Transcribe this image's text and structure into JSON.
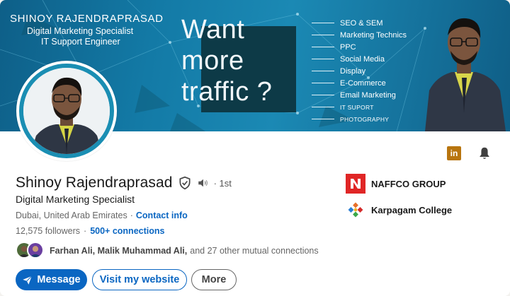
{
  "banner": {
    "name": "SHINOY RAJENDRAPRASAD",
    "subtitle1": "Digital Marketing Specialist",
    "subtitle2": "IT Support Engineer",
    "headline": [
      "Want",
      "more",
      "traffic ?"
    ],
    "services": [
      "SEO & SEM",
      "Marketing Technics",
      "PPC",
      "Social Media",
      "Display",
      "E-Commerce",
      "Email Marketing",
      "IT SUPORT",
      "PHOTOGRAPHY"
    ]
  },
  "profile": {
    "name": "Shinoy Rajendraprasad",
    "degree": "· 1st",
    "headline": "Digital Marketing Specialist",
    "location": "Dubai, United Arab Emirates",
    "contact_label": "Contact info",
    "followers": "12,575 followers",
    "connections": "500+ connections",
    "mutual_names": "Farhan Ali, Malik Muhammad Ali,",
    "mutual_rest": "and 27 other mutual connections"
  },
  "companies": [
    {
      "name": "NAFFCO GROUP",
      "logo": "naffco-logo",
      "color": "#e02626"
    },
    {
      "name": "Karpagam College",
      "logo": "karpagam-logo"
    }
  ],
  "icons": {
    "linkedin_badge": "in",
    "bell": "bell-icon",
    "verify": "verified-shield-icon",
    "speaker": "speaker-icon"
  },
  "actions": {
    "message": "Message",
    "website": "Visit my website",
    "more": "More"
  },
  "colors": {
    "accent": "#0a66c2",
    "banner": "#137aa6",
    "avatar_ring": "#1a8eb3",
    "linkedin_badge": "#b8750f"
  }
}
